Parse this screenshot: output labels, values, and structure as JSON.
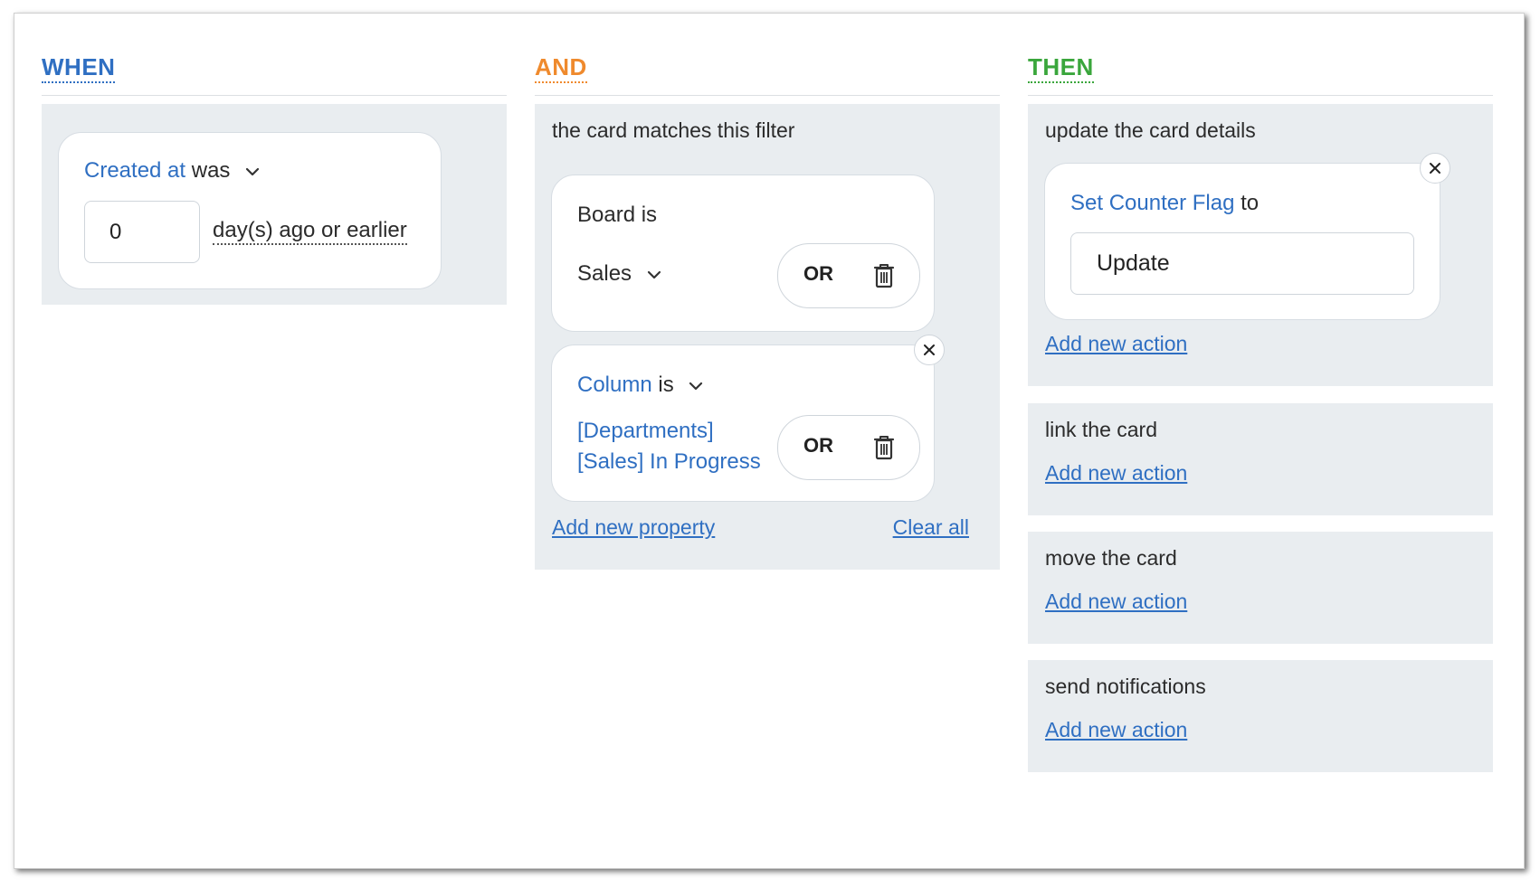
{
  "when": {
    "title": "WHEN",
    "condition": {
      "field": "Created at",
      "verb": "was",
      "value": "0",
      "unit": "day(s) ago or earlier"
    }
  },
  "and": {
    "title": "AND",
    "heading": "the card matches this filter",
    "filters": [
      {
        "field": "Board",
        "verb": "is",
        "value": "Sales",
        "or_label": "OR"
      },
      {
        "field": "Column",
        "verb": "is",
        "value_line1": "[Departments]",
        "value_line2": "[Sales] In Progress",
        "or_label": "OR"
      }
    ],
    "add_property": "Add new property",
    "clear_all": "Clear all"
  },
  "then": {
    "title": "THEN",
    "sections": [
      {
        "heading": "update the card details",
        "add_action": "Add new action"
      },
      {
        "heading": "link the card",
        "add_action": "Add new action"
      },
      {
        "heading": "move the card",
        "add_action": "Add new action"
      },
      {
        "heading": "send notifications",
        "add_action": "Add new action"
      }
    ],
    "update_action": {
      "field": "Set Counter Flag",
      "verb": "to",
      "value": "Update"
    }
  },
  "colors": {
    "when": "#2f6fc2",
    "and": "#ef8a2d",
    "then": "#3aa63c",
    "link": "#2f6fc2",
    "panel_bg": "#e9edf0"
  }
}
